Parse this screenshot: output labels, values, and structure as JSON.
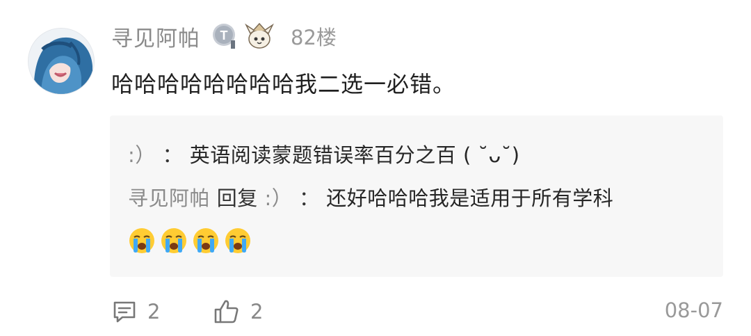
{
  "comment": {
    "username": "寻见阿帕",
    "badge_letter": "T",
    "floor": "82楼",
    "text": "哈哈哈哈哈哈哈哈我二选一必错。"
  },
  "replies": [
    {
      "author": ":）",
      "separator": "：",
      "text": "英语阅读蒙题错误率百分之百 ( ˘ᴗ˘)"
    },
    {
      "author": "寻见阿帕",
      "reply_word": "回复",
      "target": ":）",
      "separator": "：",
      "text": "还好哈哈哈我是适用于所有学科",
      "emoji_name": "loudly-crying-face",
      "emoji_count": 4
    }
  ],
  "footer": {
    "comment_count": "2",
    "like_count": "2",
    "date": "08-07"
  },
  "colors": {
    "username": "#8a8a8a",
    "reply_bg": "#f7f7f7",
    "body_text": "#1f1f1f"
  }
}
